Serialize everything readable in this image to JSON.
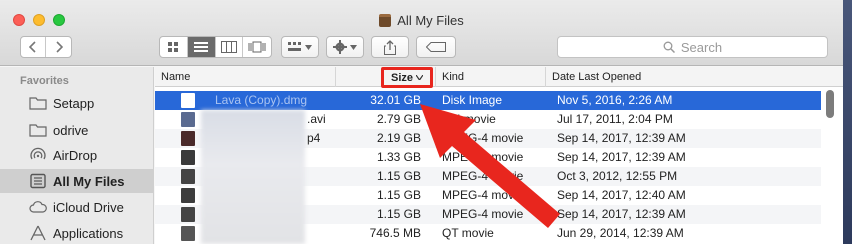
{
  "window": {
    "title": "All My Files",
    "search_placeholder": "Search"
  },
  "sidebar": {
    "heading": "Favorites",
    "items": [
      {
        "label": "Setapp",
        "icon": "folder-icon"
      },
      {
        "label": "odrive",
        "icon": "folder-icon"
      },
      {
        "label": "AirDrop",
        "icon": "airdrop-icon"
      },
      {
        "label": "All My Files",
        "icon": "all-files-icon",
        "selected": true
      },
      {
        "label": "iCloud Drive",
        "icon": "cloud-icon"
      },
      {
        "label": "Applications",
        "icon": "applications-icon"
      }
    ]
  },
  "columns": {
    "name": "Name",
    "size": "Size",
    "kind": "Kind",
    "date": "Date Last Opened"
  },
  "rows": [
    {
      "name": "Lava (Copy).dmg",
      "size": "32.01 GB",
      "kind": "Disk Image",
      "date": "Nov 5, 2016, 2:26 AM",
      "selected": true
    },
    {
      "name": ".avi",
      "size": "2.79 GB",
      "kind": "AVI movie",
      "date": "Jul 17, 2011, 2:04 PM"
    },
    {
      "name": "p4",
      "size": "2.19 GB",
      "kind": "MPEG-4 movie",
      "date": "Sep 14, 2017, 12:39 AM"
    },
    {
      "name": "",
      "size": "1.33 GB",
      "kind": "MPEG-4 movie",
      "date": "Sep 14, 2017, 12:39 AM"
    },
    {
      "name": "",
      "size": "1.15 GB",
      "kind": "MPEG-4 movie",
      "date": "Oct 3, 2012, 12:55 PM"
    },
    {
      "name": "",
      "size": "1.15 GB",
      "kind": "MPEG-4 movie",
      "date": "Sep 14, 2017, 12:40 AM"
    },
    {
      "name": "",
      "size": "1.15 GB",
      "kind": "MPEG-4 movie",
      "date": "Sep 14, 2017, 12:39 AM"
    },
    {
      "name": "",
      "size": "746.5 MB",
      "kind": "QT movie",
      "date": "Jun 29, 2014, 12:39 AM"
    }
  ],
  "colors": {
    "selection": "#2868d8",
    "annotation": "#e8261e"
  }
}
